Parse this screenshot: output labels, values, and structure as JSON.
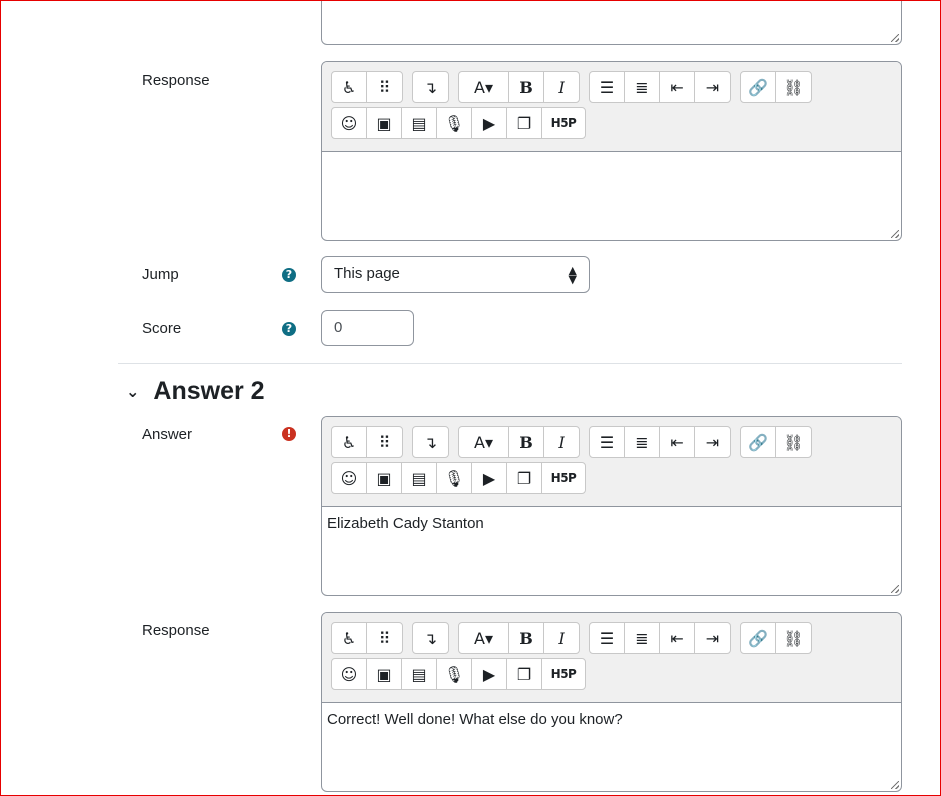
{
  "fields": {
    "response1_label": "Response",
    "jump_label": "Jump",
    "jump_value": "This page",
    "score_label": "Score",
    "score_value": "0",
    "answer_label": "Answer",
    "response2_label": "Response"
  },
  "section": {
    "title": "Answer 2"
  },
  "editors": {
    "response1_content": "",
    "answer2_content": "Elizabeth Cady Stanton",
    "response2_content": "Correct! Well done! What else do you know?"
  },
  "toolbar": {
    "font_label": "A",
    "bold_label": "B",
    "italic_label": "I",
    "h5p_label": "H5P"
  },
  "icons": {
    "help": "question-circle-icon",
    "required": "exclamation-circle-icon"
  },
  "colors": {
    "help": "#0f6e84",
    "error": "#ca3120"
  }
}
